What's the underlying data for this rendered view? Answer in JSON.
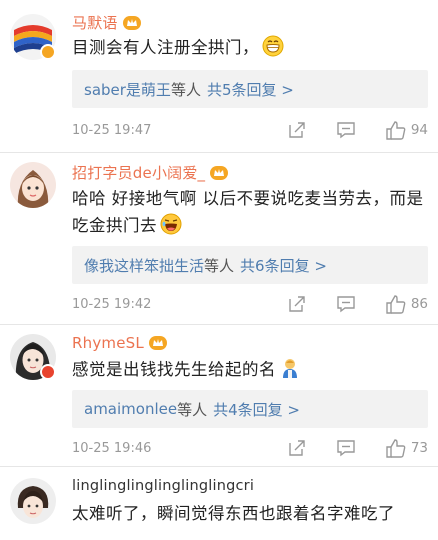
{
  "comments": [
    {
      "username": "马默语",
      "text": "目测会有人注册全拱门，",
      "emoji": "grin-emoji",
      "reply_who": "saber是萌王",
      "reply_etal": "等人",
      "reply_count": "共5条回复 >",
      "time": "10-25 19:47",
      "likes": "94"
    },
    {
      "username": "招打字员de小阔爱_",
      "text": "哈哈 好接地气啊 以后不要说吃麦当劳去，而是 吃金拱门去",
      "emoji": "laugh-emoji",
      "reply_who": "像我这样笨拙生活",
      "reply_etal": "等人",
      "reply_count": "共6条回复 >",
      "time": "10-25 19:42",
      "likes": "86"
    },
    {
      "username": "RhymeSL",
      "text": "感觉是出钱找先生给起的名",
      "emoji": "person-emoji",
      "reply_who": "amaimonlee",
      "reply_etal": "等人",
      "reply_count": "共4条回复 >",
      "time": "10-25 19:46",
      "likes": "73"
    },
    {
      "username": "linglinglinglinglinglingcri",
      "text": "太难听了，瞬间觉得东西也跟着名字难吃了"
    }
  ],
  "icons": {
    "share": "share-icon",
    "comment": "comment-icon",
    "like": "thumbs-up-icon"
  },
  "colors": {
    "username": "#eb7350",
    "link": "#507daf",
    "reply_bg": "#f2f2f2",
    "meta": "#999999"
  }
}
